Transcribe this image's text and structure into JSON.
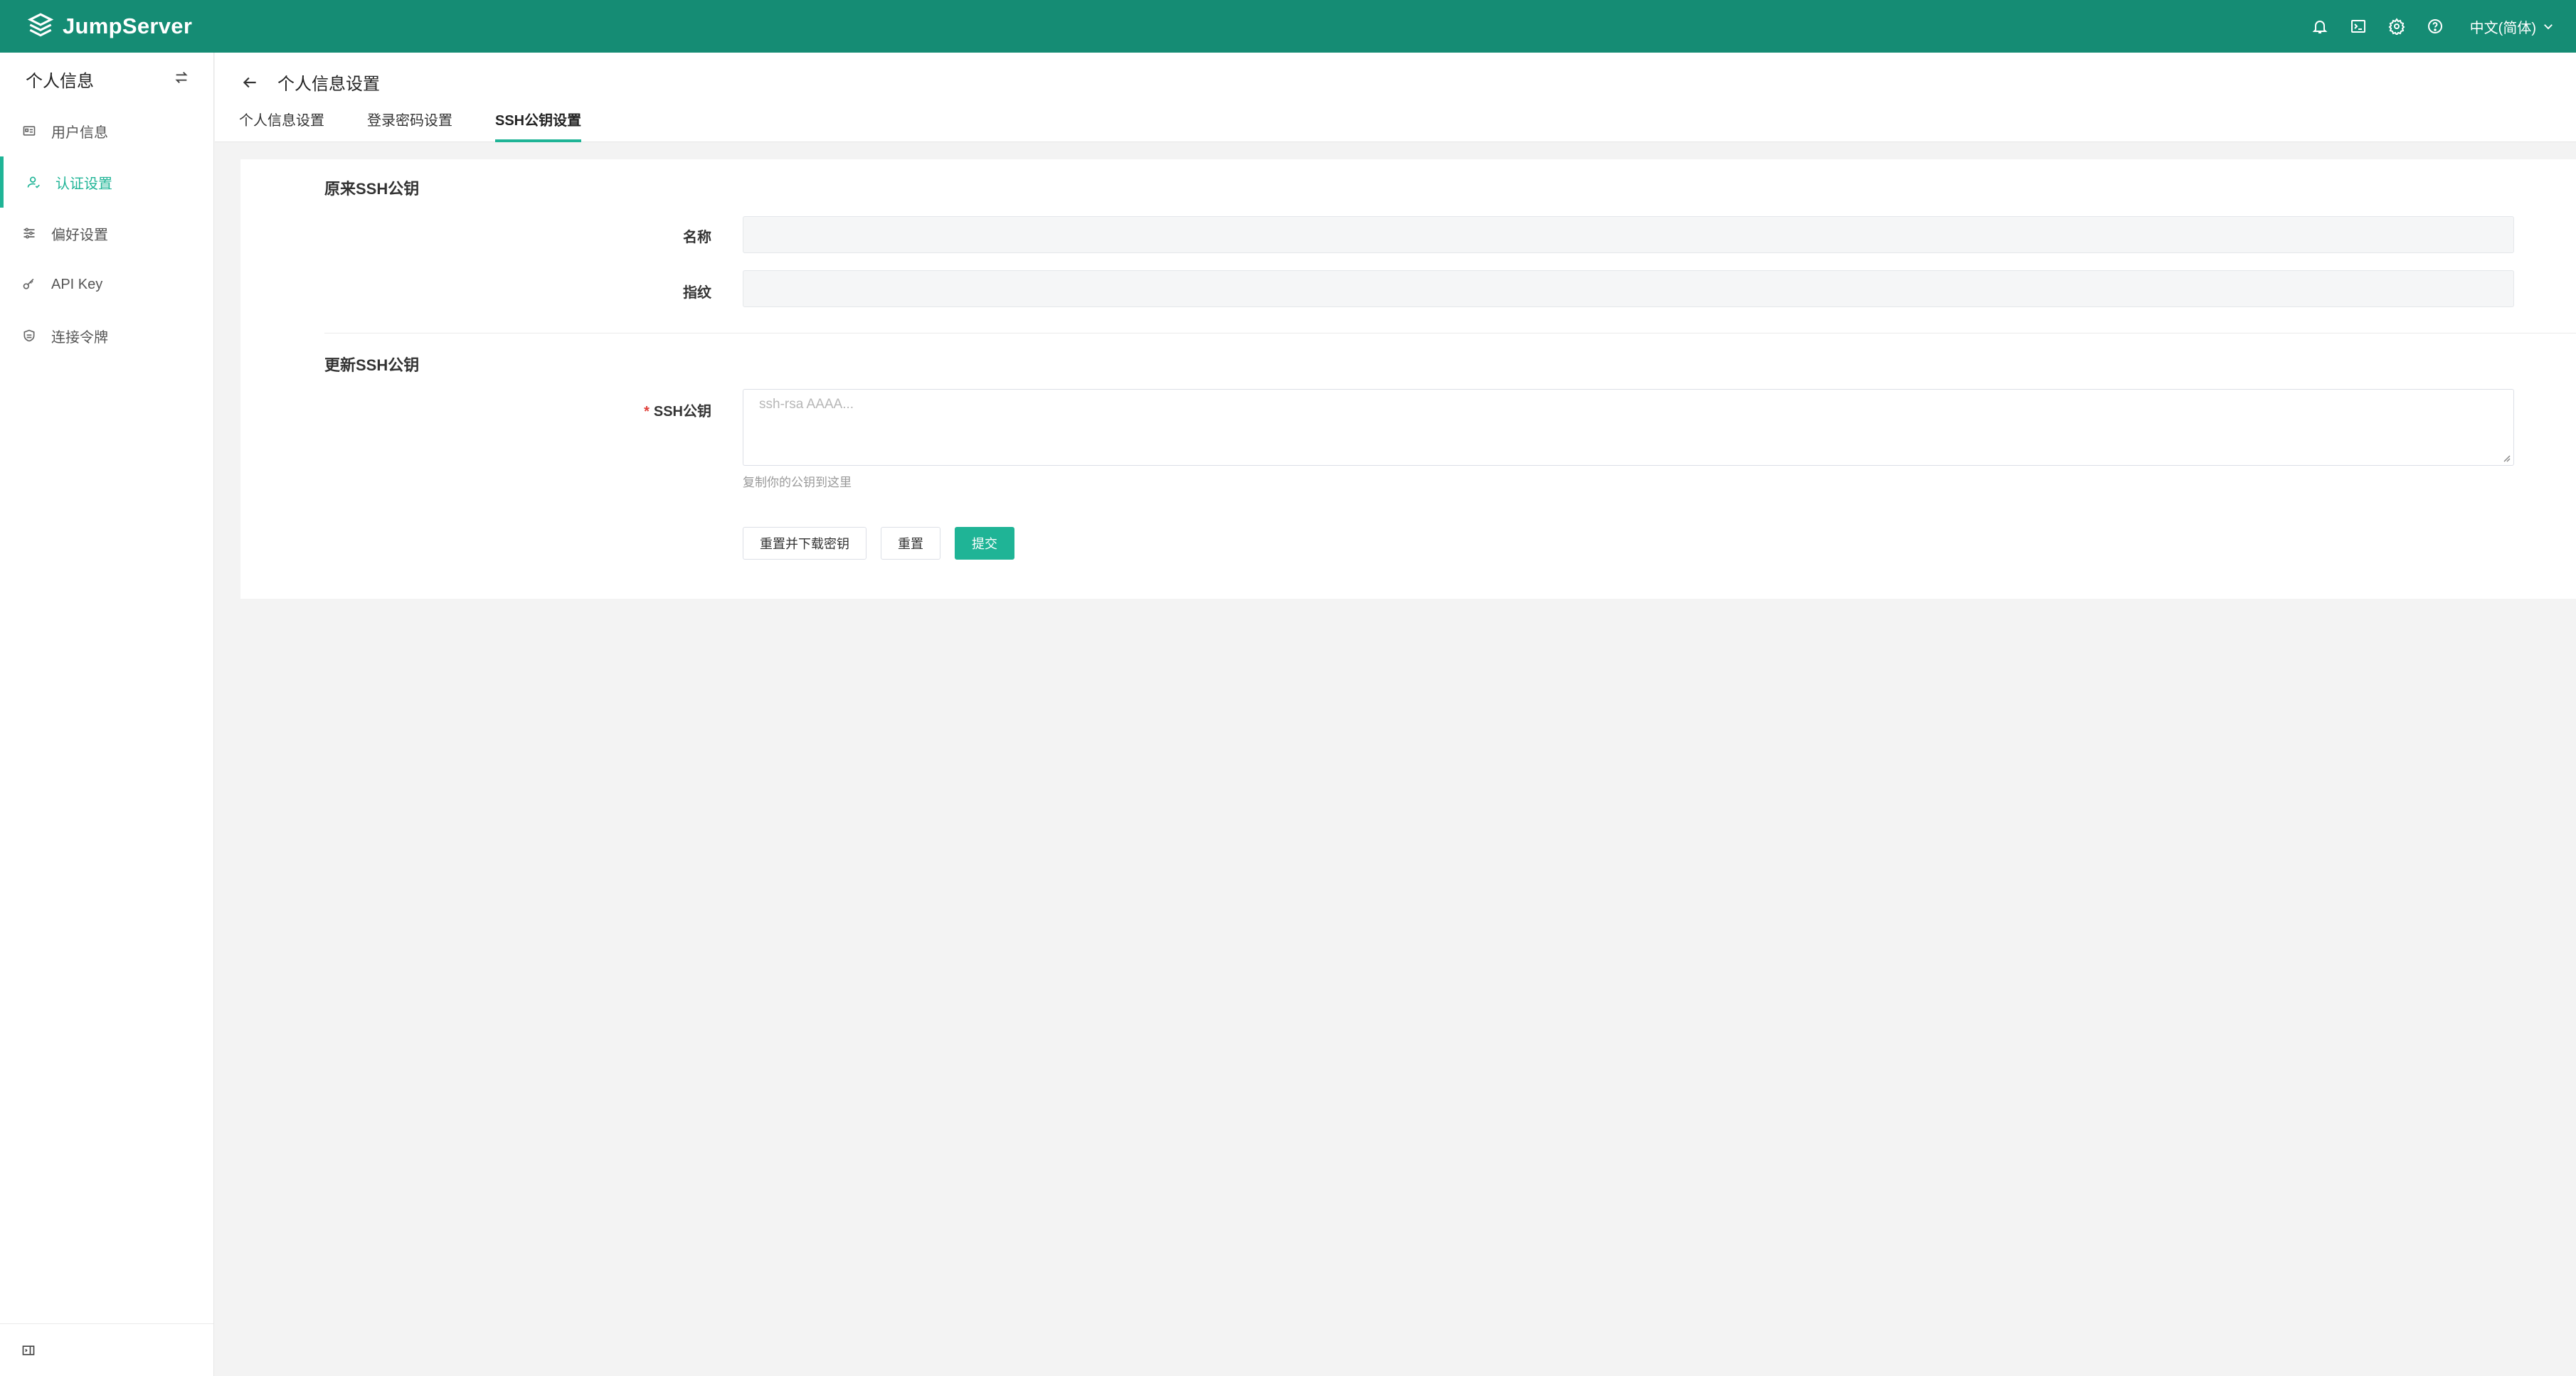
{
  "app": {
    "name": "JumpServer",
    "accent": "#1fb496",
    "navbar_color": "#158c74"
  },
  "topbar": {
    "icons": [
      "bell-icon",
      "terminal-icon",
      "gear-icon",
      "help-icon"
    ],
    "language": "中文(简体)"
  },
  "sidebar": {
    "title": "个人信息",
    "items": [
      {
        "label": "用户信息",
        "icon": "id-card-icon"
      },
      {
        "label": "认证设置",
        "icon": "user-icon",
        "active": true
      },
      {
        "label": "偏好设置",
        "icon": "sliders-icon"
      },
      {
        "label": "API Key",
        "icon": "key-icon"
      },
      {
        "label": "连接令牌",
        "icon": "token-icon"
      }
    ]
  },
  "header": {
    "title": "个人信息设置",
    "tabs": [
      {
        "label": "个人信息设置"
      },
      {
        "label": "登录密码设置"
      },
      {
        "label": "SSH公钥设置",
        "active": true
      }
    ]
  },
  "form": {
    "original_section": "原来SSH公钥",
    "name_label": "名称",
    "name_value": "",
    "fingerprint_label": "指纹",
    "fingerprint_value": "",
    "update_section": "更新SSH公钥",
    "required_mark": "*",
    "ssh_key_label": "SSH公钥",
    "ssh_key_placeholder": "ssh-rsa AAAA...",
    "help_text": "复制你的公钥到这里",
    "buttons": {
      "reset_download": "重置并下载密钥",
      "reset": "重置",
      "submit": "提交"
    }
  }
}
